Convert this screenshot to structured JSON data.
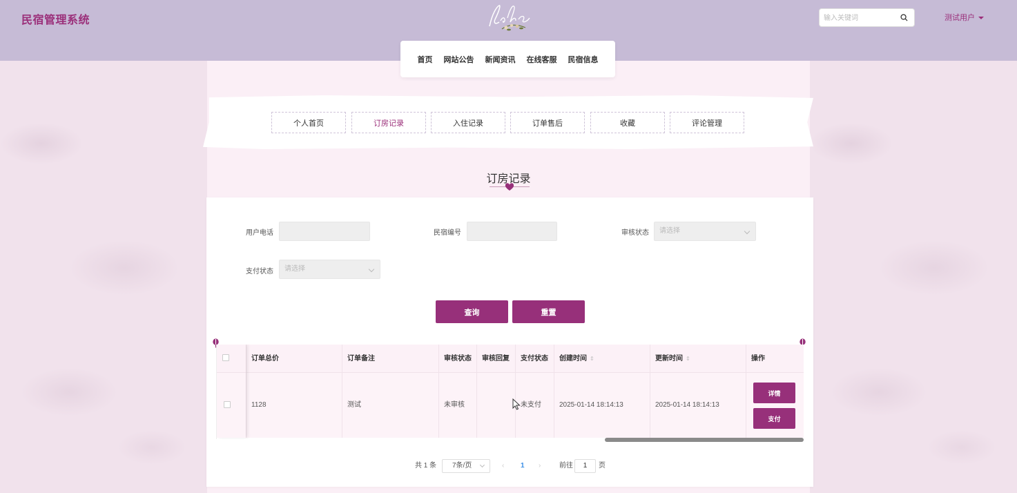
{
  "header": {
    "site_title": "民宿管理系统",
    "search_placeholder": "输入关键词",
    "user_name": "测试用户"
  },
  "nav": {
    "items": [
      "首页",
      "网站公告",
      "新闻资讯",
      "在线客服",
      "民宿信息"
    ]
  },
  "tabs": {
    "items": [
      "个人首页",
      "订房记录",
      "入住记录",
      "订单售后",
      "收藏",
      "评论管理"
    ],
    "active_index": 1
  },
  "section_title": "订房记录",
  "filters": {
    "phone_label": "用户电话",
    "homestay_no_label": "民宿编号",
    "audit_status_label": "审核状态",
    "audit_status_placeholder": "请选择",
    "pay_status_label": "支付状态",
    "pay_status_placeholder": "请选择"
  },
  "buttons": {
    "query": "查询",
    "reset": "重置"
  },
  "table": {
    "columns": [
      "订单总价",
      "订单备注",
      "审核状态",
      "审核回复",
      "支付状态",
      "创建时间",
      "更新时间",
      "操作"
    ],
    "rows": [
      {
        "total": "1128",
        "remark": "测试",
        "audit_status": "未审核",
        "audit_reply": "",
        "pay_status": "未支付",
        "created": "2025-01-14 18:14:13",
        "updated": "2025-01-14 18:14:13",
        "actions": [
          "详情",
          "支付"
        ]
      }
    ]
  },
  "pagination": {
    "total": "共 1 条",
    "page_size": "7条/页",
    "current_page": "1",
    "goto_label": "前往",
    "goto_value": "1",
    "page_unit": "页"
  },
  "colors": {
    "accent": "#97307a",
    "header_bg": "#c6bbd6"
  }
}
